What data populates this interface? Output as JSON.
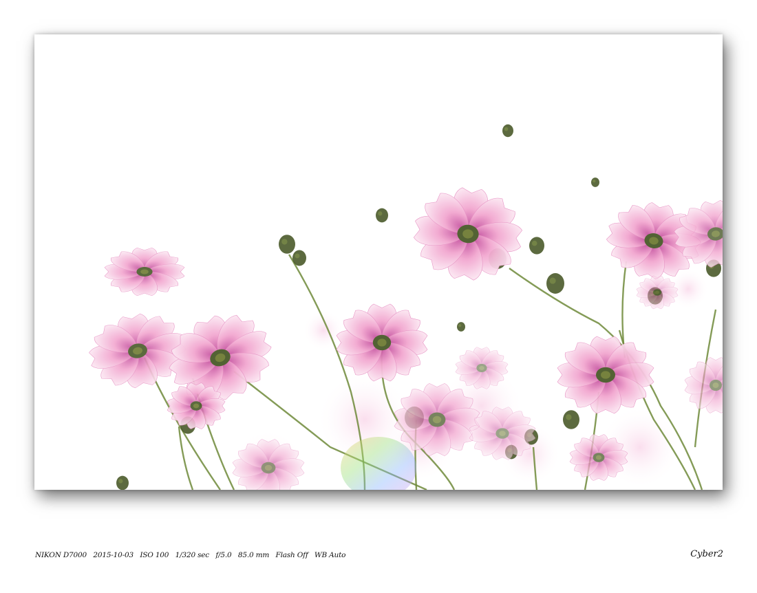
{
  "photo": {
    "subject": "pink cosmos flowers backlit against white sky",
    "colors": {
      "background": "#ffffff",
      "petal": "#f2a6cf",
      "petal_dark": "#d56aae",
      "center": "#4a5a2a",
      "stem": "#6e8a3a"
    }
  },
  "caption": {
    "exif": "NIKON D7000   2015-10-03   ISO 100   1/320 sec   f/5.0   85.0 mm   Flash Off   WB Auto",
    "signature": "Cyber2"
  }
}
